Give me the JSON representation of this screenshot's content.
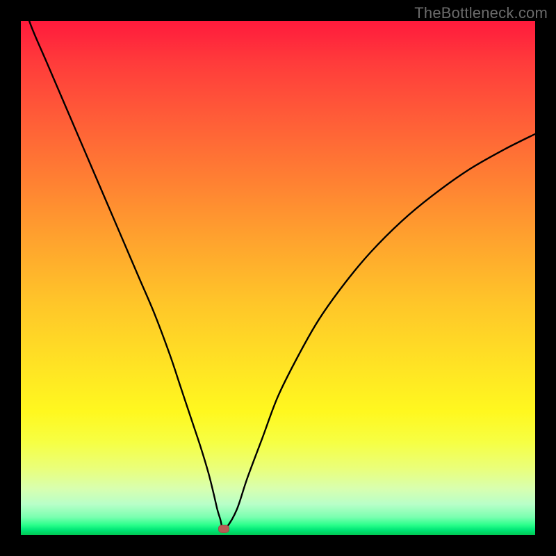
{
  "watermark": "TheBottleneck.com",
  "colors": {
    "frame": "#000000",
    "gradient_top": "#ff1a3c",
    "gradient_bottom": "#00c853",
    "curve": "#000000",
    "dot": "#b85c55"
  },
  "chart_data": {
    "type": "line",
    "title": "",
    "xlabel": "",
    "ylabel": "",
    "xlim": [
      0,
      100
    ],
    "ylim": [
      0,
      100
    ],
    "series": [
      {
        "name": "curve",
        "x": [
          0,
          2,
          5,
          8,
          11,
          14,
          17,
          20,
          23,
          26,
          29,
          31,
          33,
          35,
          36.5,
          37.5,
          38.2,
          38.8,
          39.2,
          40,
          42,
          44,
          47,
          50,
          54,
          58,
          63,
          68,
          74,
          80,
          87,
          94,
          100
        ],
        "y": [
          105,
          99,
          92,
          85,
          78,
          71,
          64,
          57,
          50,
          43,
          35,
          29,
          23,
          17,
          12,
          8,
          5,
          3,
          1.5,
          1.5,
          5,
          11,
          19,
          27,
          35,
          42,
          49,
          55,
          61,
          66,
          71,
          75,
          78
        ]
      }
    ],
    "marker": {
      "x": 39.5,
      "y": 1.2
    },
    "annotations": []
  }
}
